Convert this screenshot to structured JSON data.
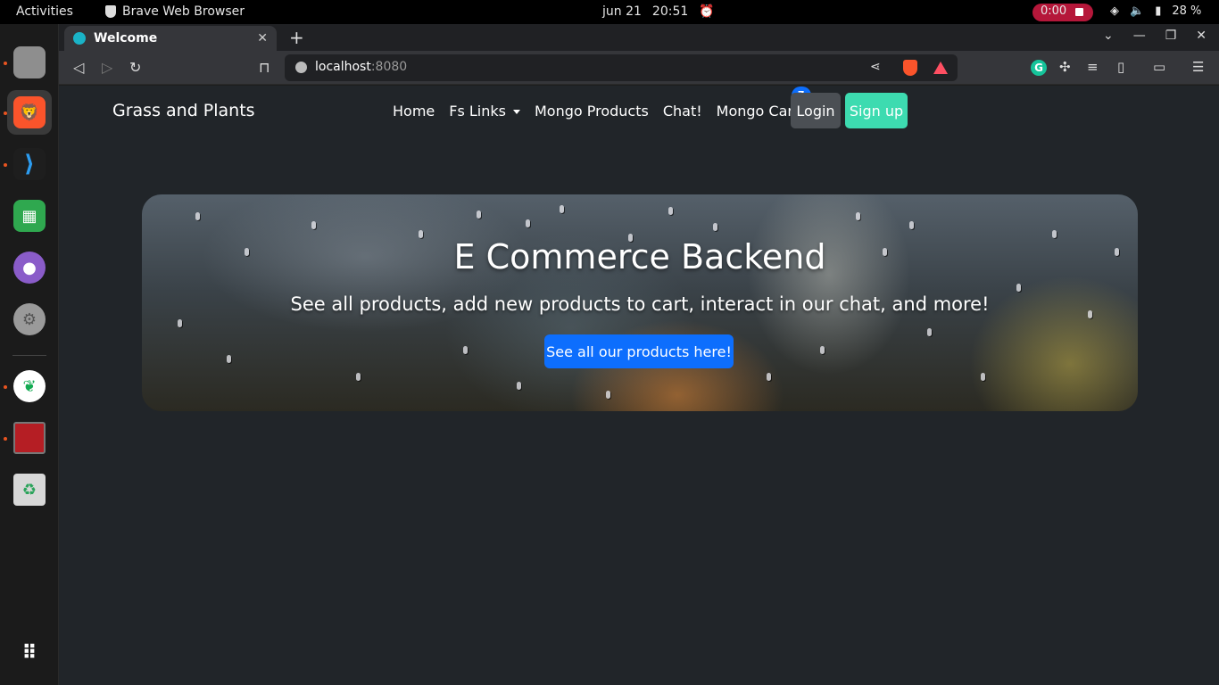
{
  "system": {
    "activities": "Activities",
    "app_name": "Brave Web Browser",
    "date": "jun 21",
    "time": "20:51",
    "recording": "0:00",
    "battery": "28 %"
  },
  "dock": {
    "items": [
      "files-icon",
      "brave-icon",
      "vscode-icon",
      "spreadsheet-icon",
      "github-desktop-icon",
      "settings-icon",
      "mongodb-compass-icon",
      "app-icon",
      "trash-icon"
    ]
  },
  "browser": {
    "tab_title": "Welcome",
    "url_host": "localhost",
    "url_port": ":8080"
  },
  "navbar": {
    "brand": "Grass and Plants",
    "links": {
      "home": "Home",
      "fs_links": "Fs Links",
      "mongo_products": "Mongo Products",
      "chat": "Chat!",
      "mongo_cart": "Mongo Cart"
    },
    "cart_count": "7",
    "login": "Login",
    "signup": "Sign up"
  },
  "hero": {
    "title": "E Commerce Backend",
    "subtitle": "See all products, add new products to cart, interact in our chat, and more!",
    "cta": "See all our products here!"
  },
  "colors": {
    "primary": "#0d6efd",
    "signup": "#3ddbb0",
    "page_bg": "#212529",
    "recording": "#b5173a"
  }
}
